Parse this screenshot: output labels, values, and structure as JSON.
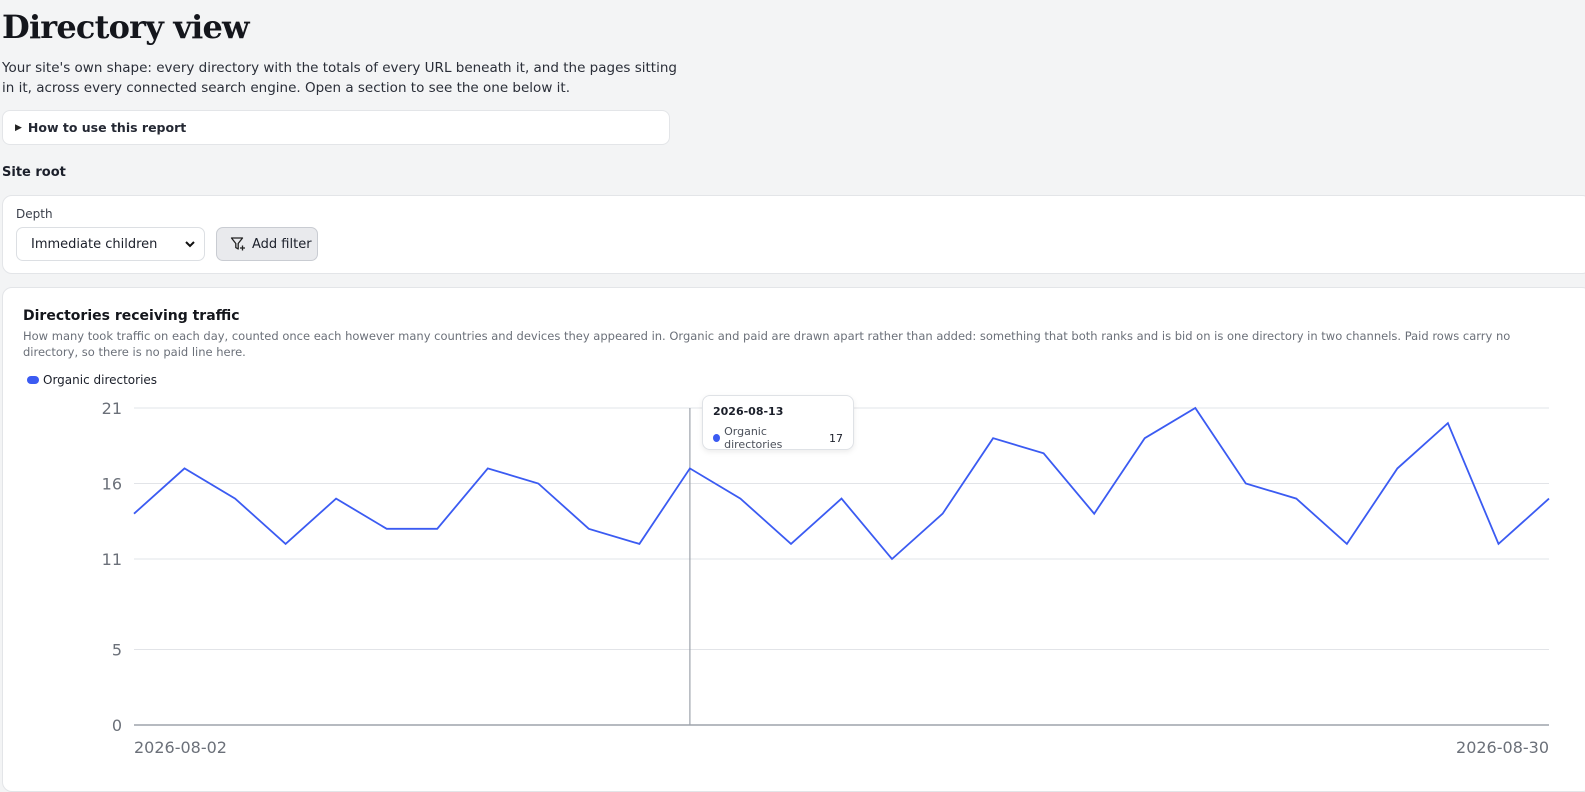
{
  "page": {
    "title": "Directory view",
    "description": "Your site's own shape: every directory with the totals of every URL beneath it, and the pages sitting in it, across every connected search engine. Open a section to see the one below it.",
    "howto_label": "How to use this report",
    "section_label": "Site root"
  },
  "filters": {
    "depth_label": "Depth",
    "depth_value": "Immediate children",
    "add_filter_label": "Add filter"
  },
  "chart_card": {
    "title": "Directories receiving traffic",
    "description": "How many took traffic on each day, counted once each however many countries and devices they appeared in. Organic and paid are drawn apart rather than added: something that both ranks and is bid on is one directory in two channels. Paid rows carry no directory, so there is no paid line here."
  },
  "tooltip": {
    "date": "2026-08-13",
    "series": "Organic directories",
    "value": "17"
  },
  "colors": {
    "series": "#3b5bf2",
    "grid": "#e2e4e8",
    "axis": "#9ea3ab"
  },
  "chart_data": {
    "type": "line",
    "x": [
      "2026-08-02",
      "2026-08-03",
      "2026-08-04",
      "2026-08-05",
      "2026-08-06",
      "2026-08-07",
      "2026-08-08",
      "2026-08-09",
      "2026-08-10",
      "2026-08-11",
      "2026-08-12",
      "2026-08-13",
      "2026-08-14",
      "2026-08-15",
      "2026-08-16",
      "2026-08-17",
      "2026-08-18",
      "2026-08-19",
      "2026-08-20",
      "2026-08-21",
      "2026-08-22",
      "2026-08-23",
      "2026-08-24",
      "2026-08-25",
      "2026-08-26",
      "2026-08-27",
      "2026-08-28",
      "2026-08-29",
      "2026-08-30"
    ],
    "x_tick_labels": [
      "2026-08-02",
      "2026-08-30"
    ],
    "series": [
      {
        "name": "Organic directories",
        "values": [
          14,
          17,
          15,
          12,
          15,
          13,
          13,
          17,
          16,
          13,
          12,
          17,
          15,
          12,
          15,
          11,
          14,
          19,
          18,
          14,
          19,
          21,
          16,
          15,
          12,
          17,
          20,
          12,
          15
        ]
      }
    ],
    "y_ticks": [
      "0",
      "5",
      "11",
      "16",
      "21"
    ],
    "ylim": [
      0,
      21
    ],
    "grid": true,
    "legend": "top-left",
    "highlight_index": 11
  }
}
